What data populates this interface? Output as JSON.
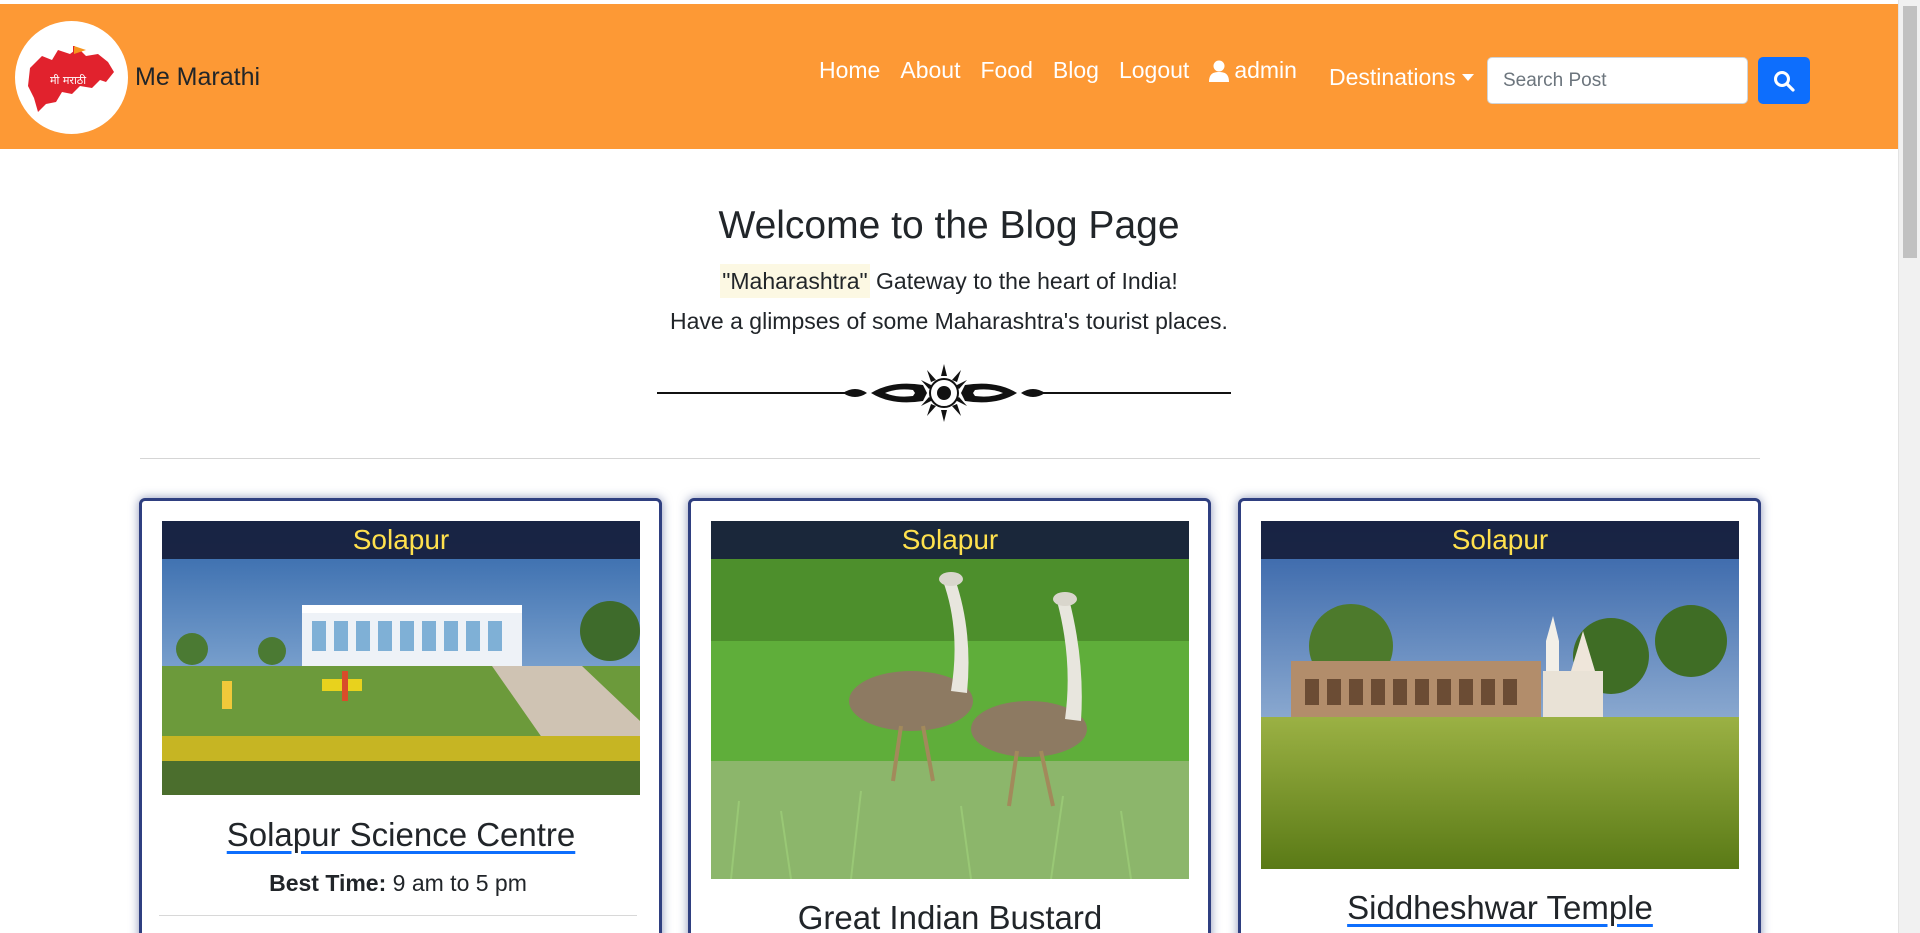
{
  "brand": {
    "name": "Me Marathi",
    "logo_text": "मी मराठी"
  },
  "nav": {
    "links": [
      "Home",
      "About",
      "Food",
      "Blog",
      "Logout"
    ],
    "user": "admin",
    "dropdown": "Destinations"
  },
  "search": {
    "placeholder": "Search Post",
    "value": ""
  },
  "hero": {
    "title": "Welcome to the Blog Page",
    "highlight": "\"Maharashtra\"",
    "line1_rest": " Gateway to the heart of India!",
    "line2": "Have a glimpses of some Maharashtra's tourist places."
  },
  "cards": [
    {
      "city": "Solapur",
      "title": "Solapur Science Centre",
      "best_time_label": "Best Time:",
      "best_time": " 9 am to 5 pm"
    },
    {
      "city": "Solapur",
      "title": "Great Indian Bustard"
    },
    {
      "city": "Solapur",
      "title": "Siddheshwar Temple"
    }
  ],
  "colors": {
    "navbar": "#fd9935",
    "search_button": "#0d6efd",
    "badge_text": "#ffe14d",
    "card_border": "#2f3f80"
  },
  "icons": {
    "search": "search-icon",
    "user": "user-icon",
    "caret": "caret-down-icon"
  }
}
